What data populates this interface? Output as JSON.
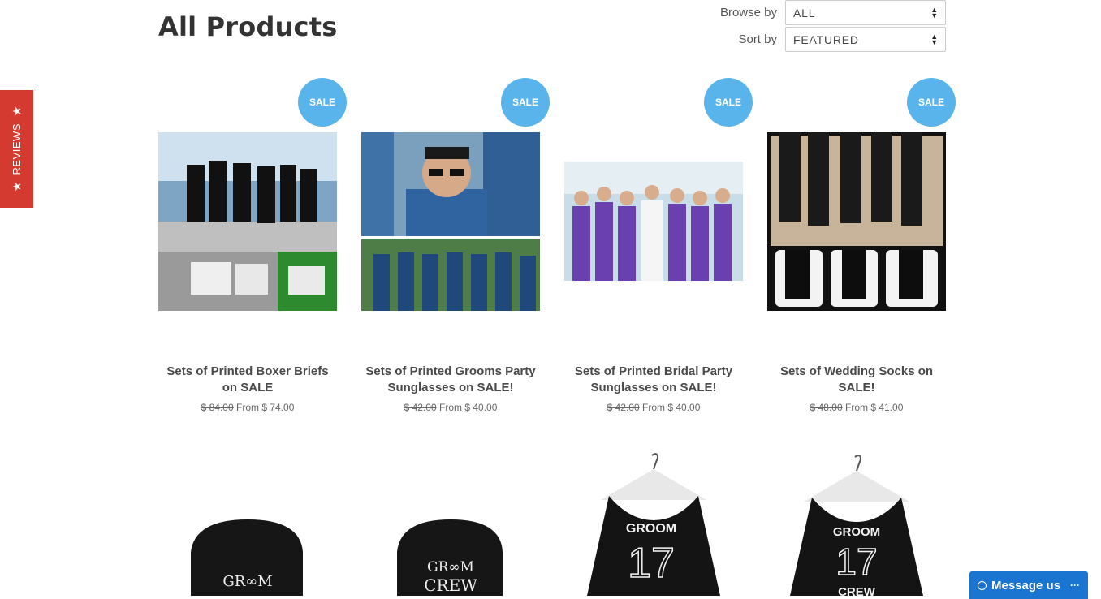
{
  "page": {
    "title": "All Products"
  },
  "filters": {
    "browse": {
      "label": "Browse by",
      "value": "ALL"
    },
    "sort": {
      "label": "Sort by",
      "value": "FEATURED"
    }
  },
  "reviews_tab": {
    "label": "REVIEWS",
    "icon": "star-icon"
  },
  "products": [
    {
      "name": "Sets of Printed Boxer Briefs on SALE",
      "badge": "SALE",
      "old_price": "$ 84.00",
      "price": "From $ 74.00"
    },
    {
      "name": "Sets of Printed Grooms Party Sunglasses on SALE!",
      "badge": "SALE",
      "old_price": "$ 42.00",
      "price": "From $ 40.00"
    },
    {
      "name": "Sets of Printed Bridal Party Sunglasses on SALE!",
      "badge": "SALE",
      "old_price": "$ 42.00",
      "price": "From $ 40.00"
    },
    {
      "name": "Sets of Wedding Socks on SALE!",
      "badge": "SALE",
      "old_price": "$ 48.00",
      "price": "From $ 41.00"
    }
  ],
  "product_images_row2": [
    {
      "text": "GR∞M",
      "icon": "trucker-hat-image"
    },
    {
      "text1": "GR∞M",
      "text2": "CREW",
      "icon": "trucker-hat-image"
    },
    {
      "text1": "GROOM",
      "text2": "17",
      "icon": "tank-top-image"
    },
    {
      "text1": "GROOM",
      "text2": "17",
      "text3": "CREW",
      "icon": "tank-top-image"
    }
  ],
  "message_widget": {
    "label": "Message us",
    "more": "···"
  },
  "colors": {
    "sale_badge": "#5ab4ec",
    "reviews_tab": "#d43a2f",
    "message_widget": "#1a75d1"
  }
}
